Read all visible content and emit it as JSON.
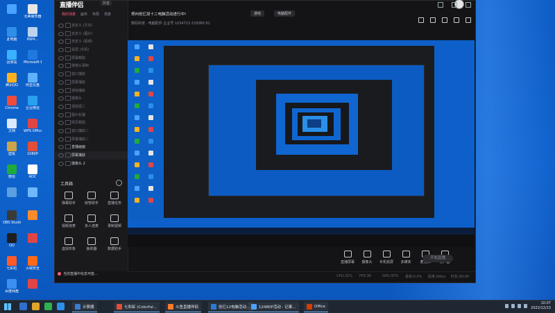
{
  "desktop": {
    "icons": [
      {
        "label": ""
      },
      {
        "label": "北美服务器"
      },
      {
        "label": "此电脑"
      },
      {
        "label": "RW4..."
      },
      {
        "label": "回收站"
      },
      {
        "label": "Microsoft Edge"
      },
      {
        "label": "腾讯QQ"
      },
      {
        "label": "阿里云盘"
      },
      {
        "label": "Chrome"
      },
      {
        "label": "企业微信"
      },
      {
        "label": "文档"
      },
      {
        "label": "WPS Office"
      },
      {
        "label": "壁纸"
      },
      {
        "label": "1080P"
      },
      {
        "label": "微信"
      },
      {
        "label": "ADC"
      },
      {
        "label": ""
      },
      {
        "label": ""
      },
      {
        "label": "OBS Studio"
      },
      {
        "label": ""
      },
      {
        "label": "QQ"
      },
      {
        "label": ""
      },
      {
        "label": "七彩虹"
      },
      {
        "label": "火绒安全"
      },
      {
        "label": "百度网盘"
      },
      {
        "label": ""
      }
    ]
  },
  "app": {
    "logo": "直播伴侣",
    "version_badge": "抖音",
    "sidebar_tabs": [
      {
        "label": "我的场景",
        "active": true
      },
      {
        "label": "画布",
        "active": false
      },
      {
        "label": "布局",
        "active": false
      },
      {
        "label": "场景",
        "active": false
      }
    ],
    "scenes": [
      "自定义 (文本)",
      "自定义 (图片)",
      "自定义 (视频)",
      "投屏 (手机)",
      "屏幕截取",
      "摄像头录制",
      "窗口捕获",
      "屏幕捕获",
      "游戏捕获",
      "摄像头",
      "视频源二",
      "图片轮播",
      "网页截取",
      "窗口捕获二",
      "屏幕捕获二",
      "直播画面",
      "屏幕捕获",
      "摄像头 2"
    ],
    "selected_scene_index": 16,
    "tools_title": "工具箱",
    "tools": [
      {
        "label": "弹幕助手",
        "icon": "chat-icon"
      },
      {
        "label": "房管助手",
        "icon": "user-icon"
      },
      {
        "label": "直播任务",
        "icon": "task-icon"
      },
      {
        "label": "视频连麦",
        "icon": "video-icon"
      },
      {
        "label": "多人连麦",
        "icon": "group-icon"
      },
      {
        "label": "录制视频",
        "icon": "record-icon"
      },
      {
        "label": "虚拟形象",
        "icon": "avatar-icon"
      },
      {
        "label": "抽奖器",
        "icon": "gift-icon"
      },
      {
        "label": "数据助手",
        "icon": "data-icon"
      }
    ],
    "toast": "当前直播中信息可能…",
    "header": {
      "title": "郑州创亿双十二电脑活动进行中!",
      "tag1": "游戏",
      "tag2": "电脑配件",
      "meta": "数码科技 · 电脑配件   企业号   1034713   233080   61",
      "icons": [
        "share-icon",
        "lock-icon",
        "settings-icon",
        "bell-icon",
        "expand-icon"
      ],
      "avatar": "user-avatar"
    },
    "bottom_bar": [
      {
        "label": "直播屏幕",
        "icon": "screen-icon"
      },
      {
        "label": "摄像头",
        "icon": "camera-icon"
      },
      {
        "label": "手机投屏",
        "icon": "phone-icon"
      },
      {
        "label": "多媒体",
        "icon": "media-icon"
      },
      {
        "label": "麦克风",
        "icon": "mic-icon"
      },
      {
        "label": "扬声器",
        "icon": "speaker-icon"
      }
    ],
    "start_button": "开始直播",
    "status": [
      "CPU:32%",
      "FPS:30",
      "GPU:35%",
      "丢帧:0.0%",
      "码率:0kb/s",
      "时长:00:00"
    ]
  },
  "taskbar": {
    "apps": [
      {
        "label": "计算器",
        "color": "#3a7bd5"
      },
      {
        "label": "七彩虹 (Colorful...",
        "color": "#e04f3a"
      },
      {
        "label": "斗鱼直播伴侣",
        "color": "#ff7a2a"
      },
      {
        "label": "创亿12电脑活动...",
        "color": "#2a7ad5"
      },
      {
        "label": "12480P活动 - 记事...",
        "color": "#4aa3ff"
      },
      {
        "label": "Office",
        "color": "#d83b01"
      }
    ],
    "clock_time": "10:07",
    "clock_date": "2022/12/13"
  }
}
